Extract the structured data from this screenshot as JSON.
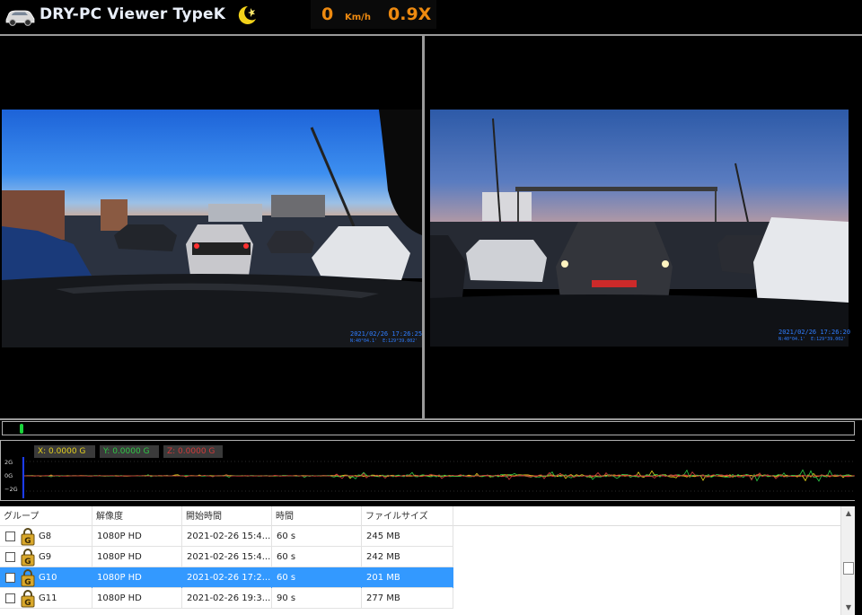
{
  "header": {
    "title": "DRY-PC Viewer TypeK",
    "speed": "0",
    "speed_unit": "Km/h",
    "playback_rate": "0.9X"
  },
  "video": {
    "front": {
      "timestamp": "2021/02/26 17:26:25",
      "coords": "N:40°04.1'  E:129°39.002'"
    },
    "rear": {
      "timestamp": "2021/02/26 17:26:20",
      "coords": "N:40°04.1'  E:129°39.002'"
    }
  },
  "gsensor": {
    "x_label": "X: 0.0000 G",
    "y_label": "Y: 0.0000 G",
    "z_label": "Z: 0.0000 G",
    "axis": [
      "2G",
      "0G",
      "−2G"
    ],
    "colors": {
      "x": "#e6d21c",
      "y": "#2ec845",
      "z": "#d23a3a"
    }
  },
  "filelist": {
    "columns": [
      "グループ",
      "解像度",
      "開始時間",
      "時間",
      "ファイルサイズ"
    ],
    "rows": [
      {
        "group": "G8",
        "resolution": "1080P HD",
        "start": "2021-02-26 15:4...",
        "duration": "60 s",
        "size": "245 MB",
        "selected": false
      },
      {
        "group": "G9",
        "resolution": "1080P HD",
        "start": "2021-02-26 15:4...",
        "duration": "60 s",
        "size": "242 MB",
        "selected": false
      },
      {
        "group": "G10",
        "resolution": "1080P HD",
        "start": "2021-02-26 17:2...",
        "duration": "60 s",
        "size": "201 MB",
        "selected": true
      },
      {
        "group": "G11",
        "resolution": "1080P HD",
        "start": "2021-02-26 19:3...",
        "duration": "90 s",
        "size": "277 MB",
        "selected": false
      }
    ]
  },
  "icons": {
    "logo": "car-icon",
    "moon": "moon-icon",
    "lock": "lock-icon"
  }
}
